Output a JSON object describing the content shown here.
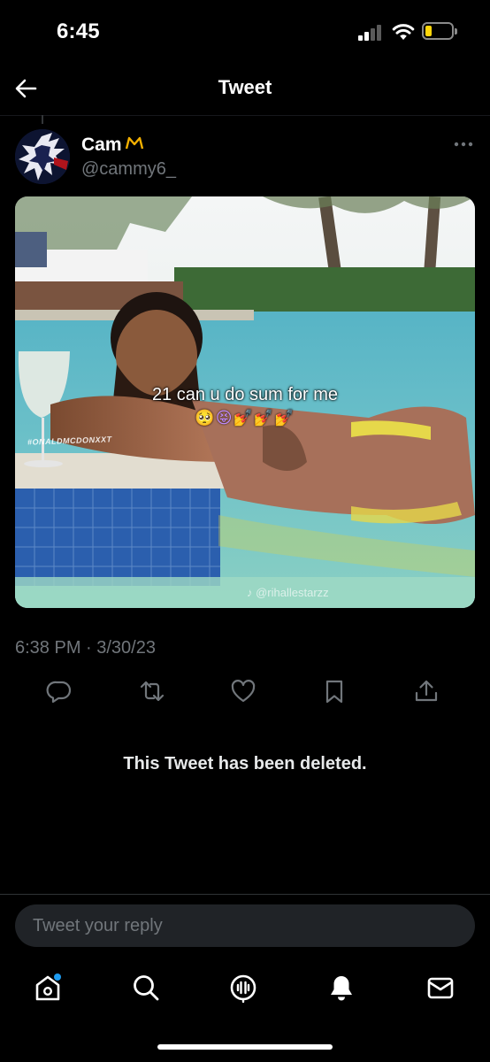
{
  "status_bar": {
    "time": "6:45",
    "signal_bars_active": 2,
    "signal_bars_total": 4,
    "battery_level": 0.25,
    "battery_color": "#ffd60a",
    "icons": [
      "cellular-signal-icon",
      "wifi-icon",
      "battery-icon"
    ]
  },
  "header": {
    "title": "Tweet",
    "back_icon": "arrow-left-icon"
  },
  "tweet": {
    "author": {
      "display_name": "Cam",
      "display_name_emoji": "crown-icon",
      "handle": "@cammy6_"
    },
    "more_icon": "more-horizontal-icon",
    "media": {
      "caption": "21 can u do sum for me",
      "emoji_line": "🥺😝💅💅💅",
      "watermark_left": "#ONALDMCDONXXT",
      "watermark_tiktok": "♪ @rihallestarzz"
    },
    "timestamp": "6:38 PM · 3/30/23",
    "actions": [
      {
        "name": "reply",
        "icon": "reply-icon"
      },
      {
        "name": "retweet",
        "icon": "retweet-icon"
      },
      {
        "name": "like",
        "icon": "heart-icon"
      },
      {
        "name": "bookmark",
        "icon": "bookmark-icon"
      },
      {
        "name": "share",
        "icon": "share-icon"
      }
    ]
  },
  "deleted_notice": "This Tweet has been deleted.",
  "reply_box": {
    "placeholder": "Tweet your reply"
  },
  "tab_bar": {
    "tabs": [
      {
        "name": "home",
        "icon": "home-icon",
        "has_notification_dot": true
      },
      {
        "name": "search",
        "icon": "search-icon"
      },
      {
        "name": "spaces",
        "icon": "spaces-icon"
      },
      {
        "name": "notifications",
        "icon": "bell-icon"
      },
      {
        "name": "messages",
        "icon": "mail-icon"
      }
    ]
  },
  "colors": {
    "background": "#000000",
    "text_primary": "#e7e9ea",
    "text_secondary": "#71767b",
    "accent": "#1d9bf0",
    "divider": "#2f3336"
  }
}
